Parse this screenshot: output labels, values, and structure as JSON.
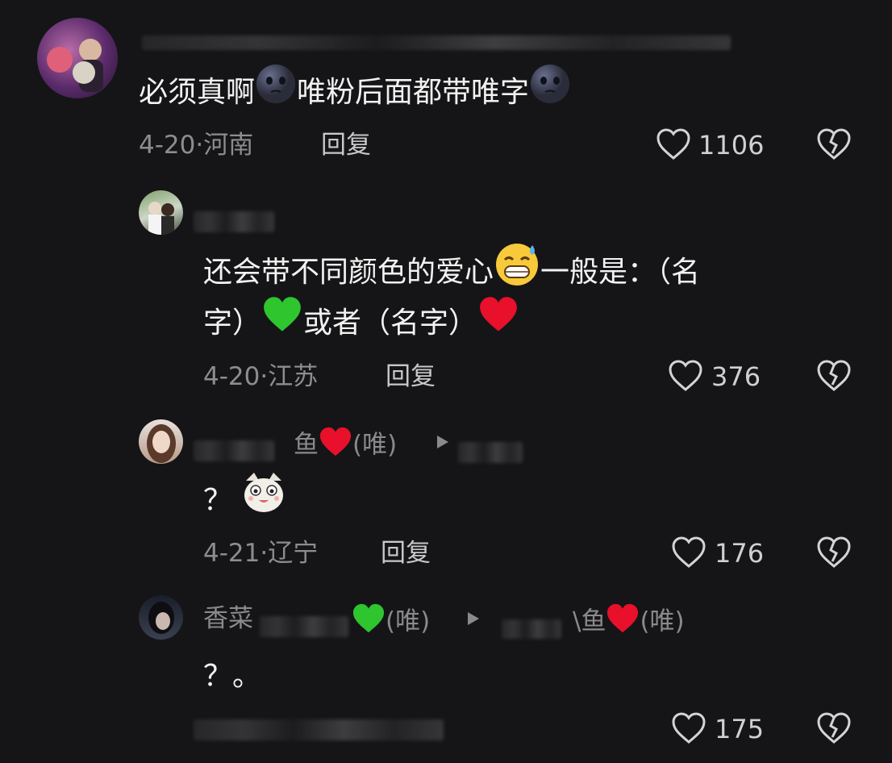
{
  "comments": [
    {
      "text_part1": "必须真啊",
      "text_part2": "唯粉后面都带唯字",
      "date": "4-20",
      "location": "河南",
      "reply_label": "回复",
      "likes": "1106",
      "emoji": "dark-moon-face"
    },
    {
      "text_line1": "还会带不同颜色的爱心",
      "text_line1b": "一般是：（名",
      "text_line2a": "字）",
      "text_line2b": "或者（名字）",
      "date": "4-20",
      "location": "江苏",
      "reply_label": "回复",
      "likes": "376"
    },
    {
      "username_part": "鱼",
      "tag": "(唯)",
      "text": "？",
      "date": "4-21",
      "location": "辽宁",
      "reply_label": "回复",
      "likes": "176"
    },
    {
      "username_prefix": "香菜",
      "tag1": "(唯)",
      "username_part2": "\\鱼",
      "tag2": "(唯)",
      "text": "？。",
      "likes": "175"
    }
  ],
  "date_separator": "·",
  "colors": {
    "background": "#151517",
    "heart_red": "#e8102a",
    "heart_green": "#2ec52e"
  },
  "icons": [
    "heart-outline-icon",
    "broken-heart-icon",
    "play-triangle-icon"
  ]
}
